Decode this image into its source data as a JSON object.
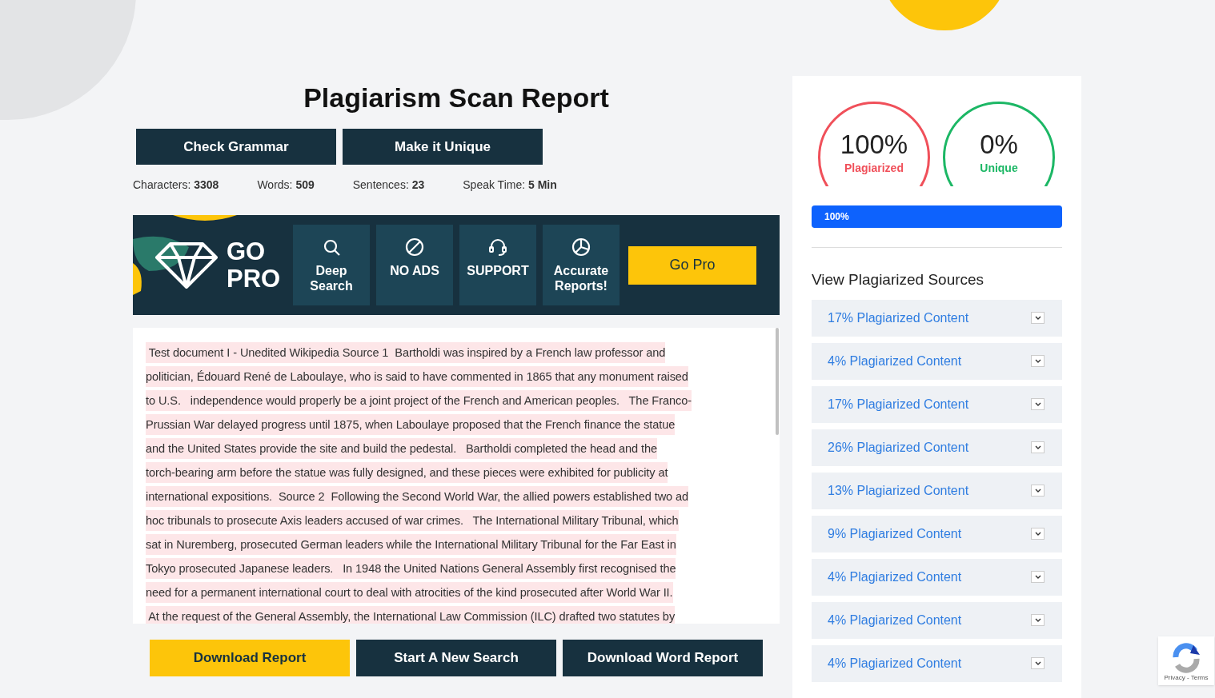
{
  "title": "Plagiarism Scan Report",
  "actions": [
    "Check Grammar",
    "Make it Unique"
  ],
  "stats": [
    "Characters: **3308**",
    "Words: **509**",
    "Sentences: **23**",
    "Speak Time: **5 Min**"
  ],
  "promo": {
    "logo_lines": [
      "GO",
      "PRO"
    ],
    "features": [
      {
        "kind": "search",
        "label": "Deep Search"
      },
      {
        "kind": "noads",
        "label": "NO ADS"
      },
      {
        "kind": "support",
        "label": "SUPPORT"
      },
      {
        "kind": "chart",
        "label": "Accurate Reports!"
      }
    ],
    "button": "Go Pro"
  },
  "text_lines": [
    " Test document I - Unedited Wikipedia Source 1  Bartholdi was inspired by a French law professor and",
    "politician, Édouard René de Laboulaye, who is said to have commented in 1865 that any monument raised",
    "to U.S.   independence would properly be a joint project of the French and American peoples.   The Franco-",
    "Prussian War delayed progress until 1875, when Laboulaye proposed that the French finance the statue",
    "and the United States provide the site and build the pedestal.   Bartholdi completed the head and the",
    "torch-bearing arm before the statue was fully designed, and these pieces were exhibited for publicity at",
    "international expositions.  Source 2  Following the Second World War, the allied powers established two ad",
    "hoc tribunals to prosecute Axis leaders accused of war crimes.   The International Military Tribunal, which",
    "sat in Nuremberg, prosecuted German leaders while the International Military Tribunal for the Far East in",
    "Tokyo prosecuted Japanese leaders.   In 1948 the United Nations General Assembly first recognised the",
    "need for a permanent international court to deal with atrocities of the kind prosecuted after World War II.",
    " At the request of the General Assembly, the International Law Commission (ILC) drafted two statutes by"
  ],
  "bottom_buttons": [
    {
      "kind": "primary",
      "label": "Download Report"
    },
    {
      "kind": "dark",
      "label": "Start A New Search"
    },
    {
      "kind": "dark",
      "label": "Download Word Report"
    }
  ],
  "scores": [
    {
      "value": "100%",
      "label": "Plagiarized",
      "color": "#f0505a"
    },
    {
      "value": "0%",
      "label": "Unique",
      "color": "#1cb765"
    }
  ],
  "progress": {
    "level": 1.0,
    "label": "100%"
  },
  "sources_title": "View Plagiarized Sources",
  "sources": [
    "17% Plagiarized Content",
    "4% Plagiarized Content",
    "17% Plagiarized Content",
    "26% Plagiarized Content",
    "13% Plagiarized Content",
    "9% Plagiarized Content",
    "4% Plagiarized Content",
    "4% Plagiarized Content",
    "4% Plagiarized Content"
  ],
  "captcha": {
    "links": "Privacy - Terms"
  }
}
